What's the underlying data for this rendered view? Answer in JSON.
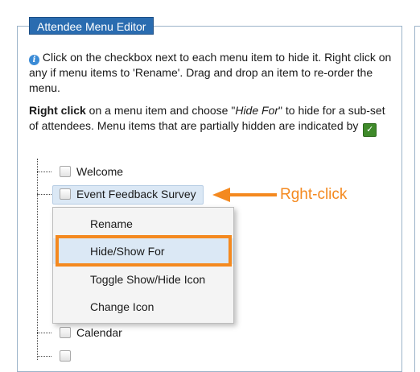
{
  "panel": {
    "title": "Attendee Menu Editor"
  },
  "intro": {
    "text": "Click on the checkbox next to each menu item to hide it. Right click on any if menu items to 'Rename'. Drag and drop an item to re-order the menu."
  },
  "hint": {
    "bold": "Right click",
    "part1": " on a menu item and choose \"",
    "italic": "Hide For",
    "part2": "\" to hide for a sub-set of attendees. Menu items that are partially hidden are indicated by"
  },
  "tree": {
    "items": [
      {
        "label": "Welcome"
      },
      {
        "label": "Event Feedback Survey"
      },
      {
        "label": "Calendar"
      }
    ]
  },
  "annotation": {
    "label": "Rght-click",
    "color": "#f4891f"
  },
  "context_menu": {
    "items": [
      {
        "label": "Rename"
      },
      {
        "label": "Hide/Show For"
      },
      {
        "label": "Toggle Show/Hide Icon"
      },
      {
        "label": "Change Icon"
      }
    ]
  },
  "colors": {
    "accent": "#2a6cb0",
    "highlight": "#f4891f",
    "partial": "#3f8a2a"
  },
  "icons": {
    "info": "info-icon",
    "partial": "check-icon"
  }
}
